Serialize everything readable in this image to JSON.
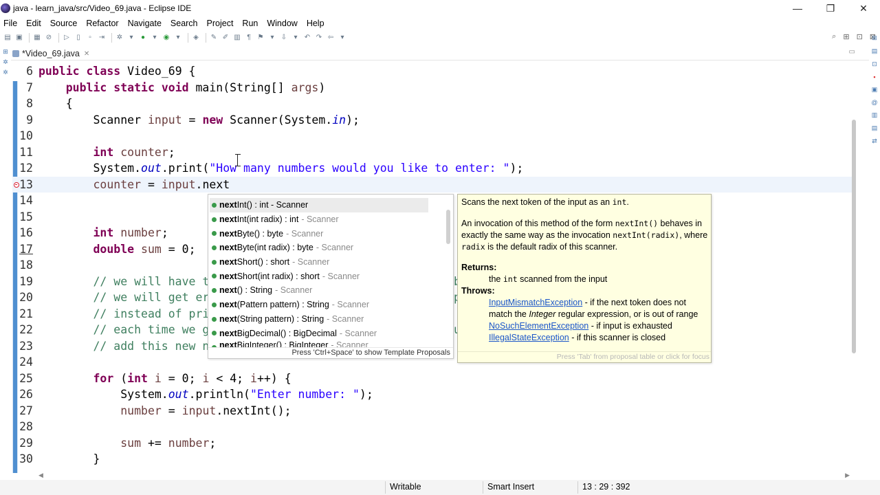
{
  "window": {
    "title": "java - learn_java/src/Video_69.java - Eclipse IDE",
    "controls": [
      "—",
      "❐",
      "✕"
    ]
  },
  "menu": [
    "File",
    "Edit",
    "Source",
    "Refactor",
    "Navigate",
    "Search",
    "Project",
    "Run",
    "Window",
    "Help"
  ],
  "editor": {
    "tab_label": "*Video_69.java",
    "tab_close": "✕"
  },
  "code_lines": [
    {
      "num": "6"
    },
    {
      "num": "7"
    },
    {
      "num": "8"
    },
    {
      "num": "9"
    },
    {
      "num": "10"
    },
    {
      "num": "11"
    },
    {
      "num": "12"
    },
    {
      "num": "13"
    },
    {
      "num": "14"
    },
    {
      "num": "15"
    },
    {
      "num": "16"
    },
    {
      "num": "17"
    },
    {
      "num": "18"
    },
    {
      "num": "19"
    },
    {
      "num": "20"
    },
    {
      "num": "21"
    },
    {
      "num": "22"
    },
    {
      "num": "23"
    },
    {
      "num": "24"
    },
    {
      "num": "25"
    },
    {
      "num": "26"
    },
    {
      "num": "27"
    },
    {
      "num": "28"
    },
    {
      "num": "29"
    },
    {
      "num": "30"
    }
  ],
  "code_text": {
    "l6_a": "public class",
    "l6_b": " Video_69 {",
    "l7_a": "    ",
    "l7_kw": "public static void",
    "l7_b": " main(String[] ",
    "l7_var": "args",
    "l7_c": ")",
    "l8": "    {",
    "l9_a": "        Scanner ",
    "l9_var": "input",
    "l9_b": " = ",
    "l9_kw": "new",
    "l9_c": " Scanner(System.",
    "l9_fld": "in",
    "l9_d": ");",
    "l11_a": "        ",
    "l11_kw": "int",
    "l11_var": " counter",
    "l11_b": ";",
    "l12_a": "        System.",
    "l12_fld": "out",
    "l12_b": ".print(",
    "l12_str": "\"How many numbers would you like to enter: \"",
    "l12_c": ");",
    "l13_a": "        ",
    "l13_var": "counter",
    "l13_b": " = ",
    "l13_var2": "input",
    "l13_c": ".next",
    "l16_a": "        ",
    "l16_kw": "int",
    "l16_var": " number",
    "l16_b": ";",
    "l17_a": "        ",
    "l17_kw": "double",
    "l17_var": " sum",
    "l17_b": " = 0;",
    "l19": "        // we will have t",
    "l19_r": "b",
    "l20": "        // we will get er",
    "l20_r": "p",
    "l21": "        // instead of pri",
    "l22": "        // each time we g",
    "l22_r": "u",
    "l23": "        // add this new n",
    "l25_a": "        ",
    "l25_kw": "for",
    "l25_b": " (",
    "l25_kw2": "int",
    "l25_var": " i",
    "l25_c": " = 0; ",
    "l25_var2": "i",
    "l25_d": " < 4; ",
    "l25_var3": "i",
    "l25_e": "++) {",
    "l26_a": "            System.",
    "l26_fld": "out",
    "l26_b": ".println(",
    "l26_str": "\"Enter number: \"",
    "l26_c": ");",
    "l27_a": "            ",
    "l27_var": "number",
    "l27_b": " = ",
    "l27_var2": "input",
    "l27_c": ".nextInt();",
    "l29_a": "            ",
    "l29_var": "sum",
    "l29_b": " += ",
    "l29_var2": "number",
    "l29_c": ";",
    "l30": "        }"
  },
  "completion": {
    "proposals": [
      {
        "bold": "next",
        "rest": "Int() : int - Scanner",
        "owner": ""
      },
      {
        "bold": "next",
        "rest": "Int(int radix) : int",
        "owner": "- Scanner"
      },
      {
        "bold": "next",
        "rest": "Byte() : byte",
        "owner": "- Scanner"
      },
      {
        "bold": "next",
        "rest": "Byte(int radix) : byte",
        "owner": "- Scanner"
      },
      {
        "bold": "next",
        "rest": "Short() : short",
        "owner": "- Scanner"
      },
      {
        "bold": "next",
        "rest": "Short(int radix) : short",
        "owner": "- Scanner"
      },
      {
        "bold": "next",
        "rest": "() : String",
        "owner": "- Scanner"
      },
      {
        "bold": "next",
        "rest": "(Pattern pattern) : String",
        "owner": "- Scanner"
      },
      {
        "bold": "next",
        "rest": "(String pattern) : String",
        "owner": "- Scanner"
      },
      {
        "bold": "next",
        "rest": "BigDecimal() : BigDecimal",
        "owner": "- Scanner"
      },
      {
        "bold": "next",
        "rest": "BigInteger() : BigInteger",
        "owner": "- Scanner"
      }
    ],
    "footer": "Press 'Ctrl+Space' to show Template Proposals"
  },
  "javadoc": {
    "p1_a": "Scans the next token of the input as an ",
    "p1_code": "int",
    "p1_b": ".",
    "p2_a": "An invocation of this method of the form ",
    "p2_code1": "nextInt()",
    "p2_b": " behaves in exactly the same way as the invocation ",
    "p2_code2": "nextInt(radix)",
    "p2_c": ", where ",
    "p2_code3": "radix",
    "p2_d": " is the default radix of this scanner.",
    "returns_label": "Returns:",
    "returns_a": "the ",
    "returns_code": "int",
    "returns_b": " scanned from the input",
    "throws_label": "Throws:",
    "ex1": "InputMismatchException",
    "ex1_desc_a": " - if the next token does not match the ",
    "ex1_desc_em": "Integer",
    "ex1_desc_b": " regular expression, or is out of range",
    "ex2": "NoSuchElementException",
    "ex2_desc": " - if input is exhausted",
    "ex3": "IllegalStateException",
    "ex3_desc": " - if this scanner is closed",
    "footer": "Press 'Tab' from proposal table or click for focus"
  },
  "status": {
    "writable": "Writable",
    "insert_mode": "Smart Insert",
    "position": "13 : 29 : 392"
  },
  "colors": {
    "keyword": "#7f0055",
    "string": "#2a00ff",
    "comment": "#3f7f5f",
    "field": "#0000c0",
    "local_var": "#6a3e3e",
    "javadoc_bg": "#ffffe1",
    "link": "#1a55c8"
  },
  "icons": {
    "title_controls": [
      "minimize-icon",
      "restore-icon",
      "close-icon"
    ],
    "error_marker": "error-marker-icon",
    "proposal": "public-method-icon"
  }
}
